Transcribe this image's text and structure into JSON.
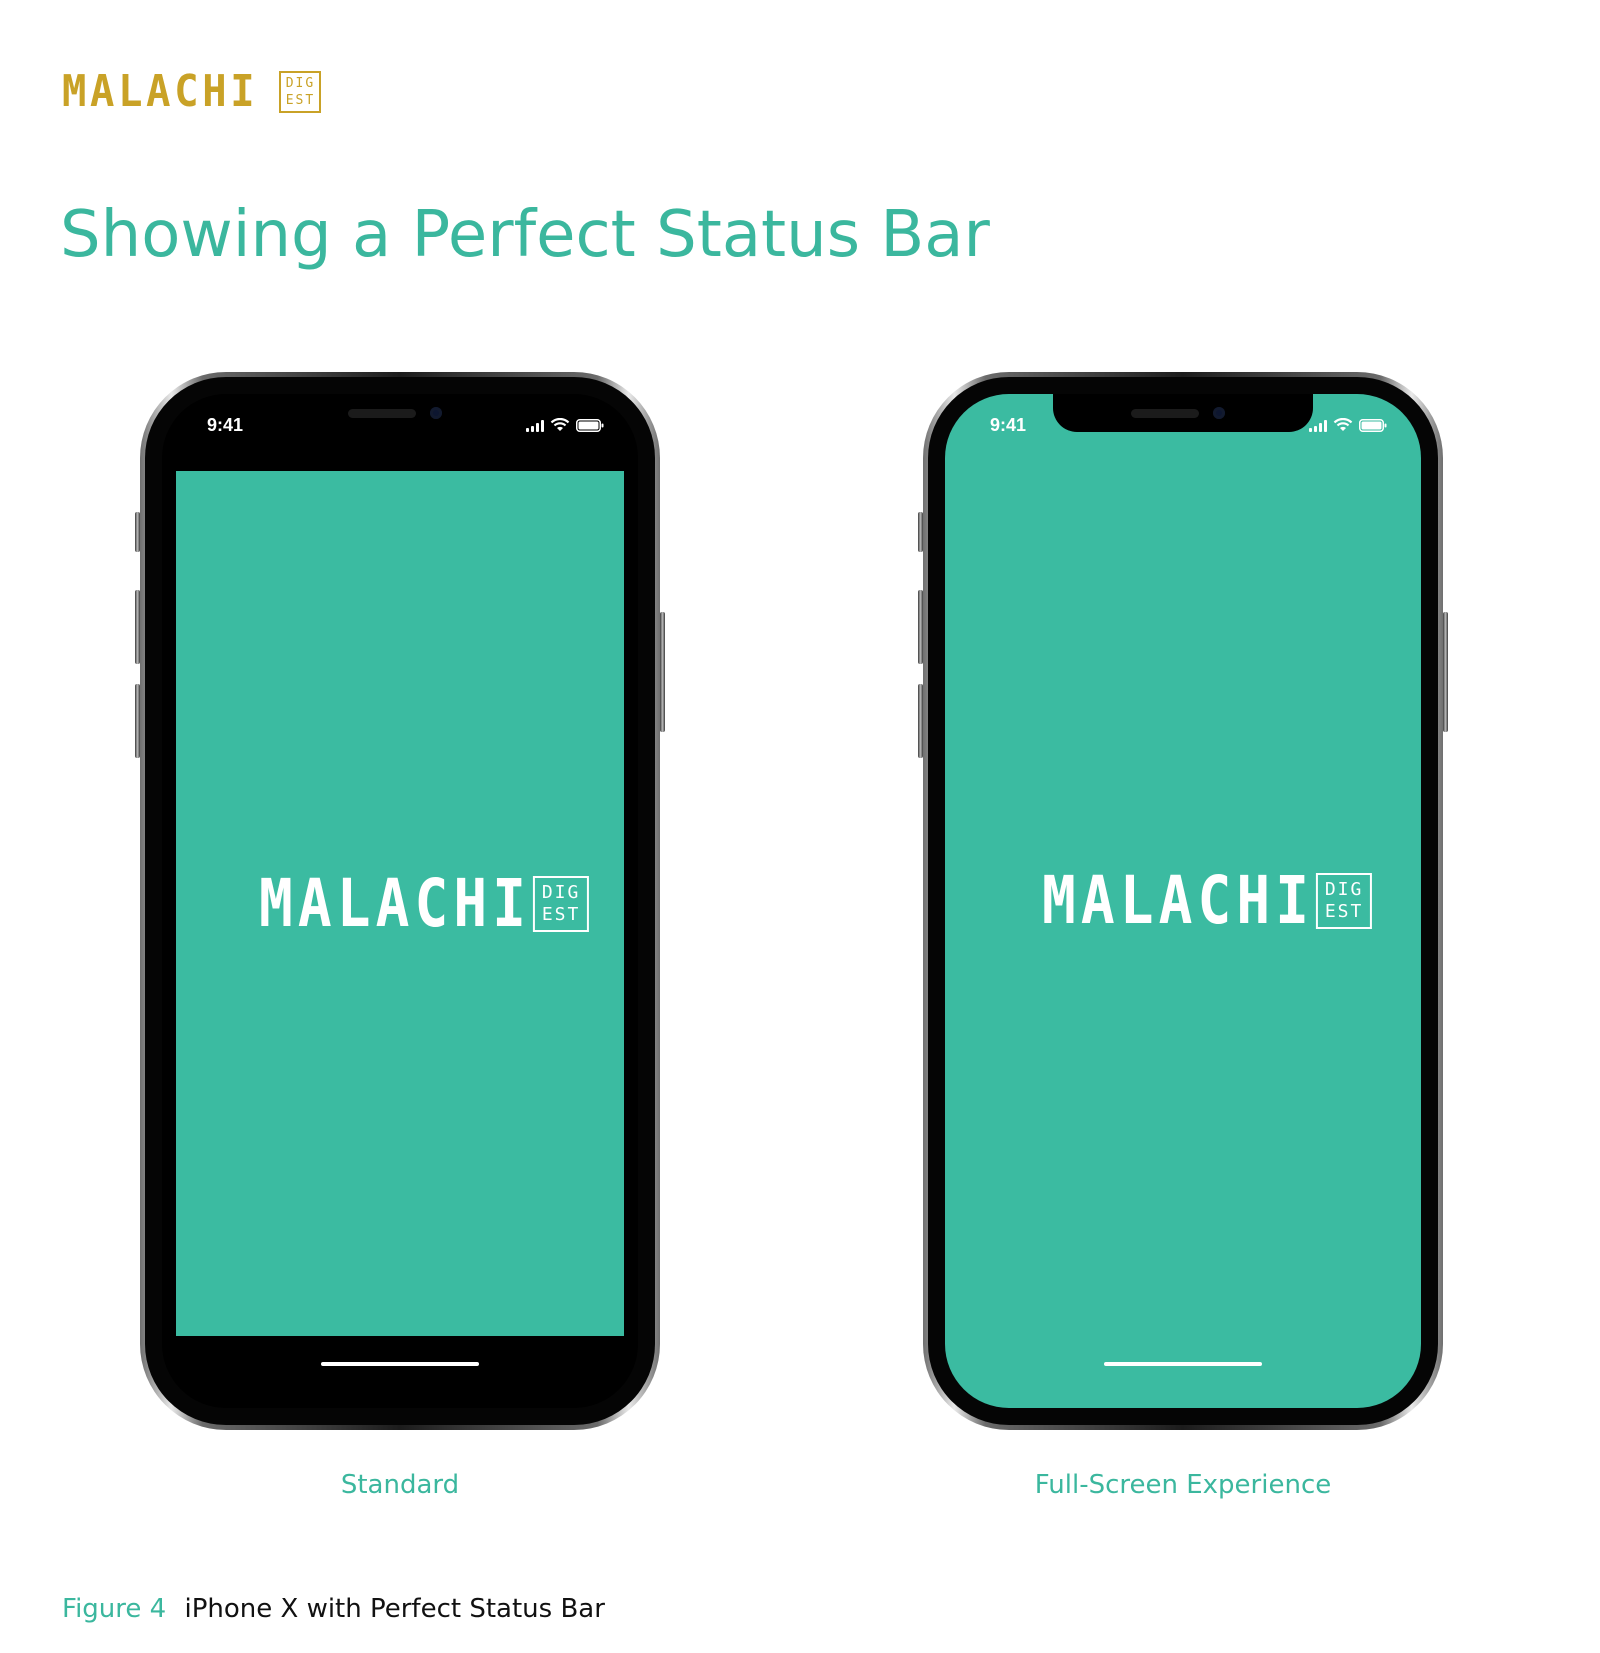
{
  "brand": {
    "wordmark": "MALACHI",
    "badge_top": "DIG",
    "badge_bottom": "EST",
    "color": "#c9a227"
  },
  "page": {
    "title": "Showing a Perfect Status Bar",
    "accent_color": "#3bb79e"
  },
  "phones": [
    {
      "status_time": "9:41",
      "logo_wordmark": "MALACHI",
      "logo_badge_top": "DIG",
      "logo_badge_bottom": "EST",
      "caption": "Standard",
      "screen_color": "#3bbba1"
    },
    {
      "status_time": "9:41",
      "logo_wordmark": "MALACHI",
      "logo_badge_top": "DIG",
      "logo_badge_bottom": "EST",
      "caption": "Full-Screen Experience",
      "screen_color": "#3bbba1"
    }
  ],
  "status_icons": [
    "signal-icon",
    "wifi-icon",
    "battery-icon"
  ],
  "figure": {
    "number": "Figure 4",
    "text": "iPhone X with Perfect Status Bar"
  }
}
